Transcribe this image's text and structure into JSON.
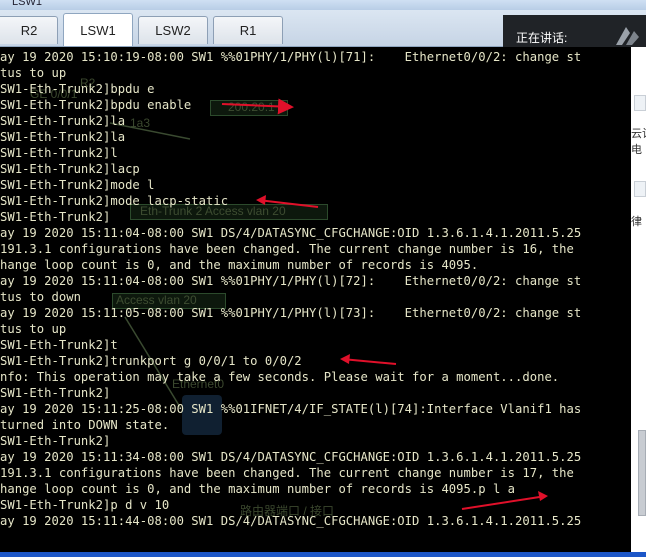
{
  "window": {
    "title": "LSW1"
  },
  "tabs": [
    {
      "label": "R2",
      "active": false
    },
    {
      "label": "LSW1",
      "active": true
    },
    {
      "label": "LSW2",
      "active": false
    },
    {
      "label": "R1",
      "active": false
    }
  ],
  "notification": {
    "text": "正在讲话:"
  },
  "terminal": {
    "lines": [
      "ay 19 2020 15:10:19-08:00 SW1 %%01PHY/1/PHY(l)[71]:    Ethernet0/0/2: change st",
      "tus to up",
      "SW1-Eth-Trunk2]bpdu e",
      "SW1-Eth-Trunk2]bpdu enable",
      "SW1-Eth-Trunk2]la",
      "SW1-Eth-Trunk2]la",
      "SW1-Eth-Trunk2]l",
      "SW1-Eth-Trunk2]lacp",
      "SW1-Eth-Trunk2]mode l",
      "SW1-Eth-Trunk2]mode lacp-static",
      "SW1-Eth-Trunk2]",
      "ay 19 2020 15:11:04-08:00 SW1 DS/4/DATASYNC_CFGCHANGE:OID 1.3.6.1.4.1.2011.5.25",
      "191.3.1 configurations have been changed. The current change number is 16, the",
      "hange loop count is 0, and the maximum number of records is 4095.",
      "ay 19 2020 15:11:04-08:00 SW1 %%01PHY/1/PHY(l)[72]:    Ethernet0/0/2: change st",
      "tus to down",
      "ay 19 2020 15:11:05-08:00 SW1 %%01PHY/1/PHY(l)[73]:    Ethernet0/0/2: change st",
      "tus to up",
      "SW1-Eth-Trunk2]t",
      "SW1-Eth-Trunk2]trunkport g 0/0/1 to 0/0/2",
      "nfo: This operation may take a few seconds. Please wait for a moment...done.",
      "SW1-Eth-Trunk2]",
      "ay 19 2020 15:11:25-08:00 SW1 %%01IFNET/4/IF_STATE(l)[74]:Interface Vlanif1 has",
      "turned into DOWN state.",
      "SW1-Eth-Trunk2]",
      "ay 19 2020 15:11:34-08:00 SW1 DS/4/DATASYNC_CFGCHANGE:OID 1.3.6.1.4.1.2011.5.25",
      "191.3.1 configurations have been changed. The current change number is 17, the",
      "hange loop count is 0, and the maximum number of records is 4095.p l a",
      "SW1-Eth-Trunk2]p d v 10",
      "ay 19 2020 15:11:44-08:00 SW1 DS/4/DATASYNC_CFGCHANGE:OID 1.3.6.1.4.1.2011.5.25"
    ]
  },
  "background_ghost": {
    "items": [
      "R2",
      "GE 0/0/1",
      "200.20.1",
      "1a3",
      "Eth-Trunk 2 Access vlan 20",
      "Access vlan 20",
      "Ethernet0",
      "路由器端口 / 接口"
    ]
  },
  "right_strip": {
    "labels": [
      "云计算",
      "电",
      "律"
    ]
  },
  "colors": {
    "terminal_bg": "#000000",
    "terminal_fg": "#e6e6c8",
    "arrow": "#e0102a",
    "taskbar": "#1d57c8"
  }
}
